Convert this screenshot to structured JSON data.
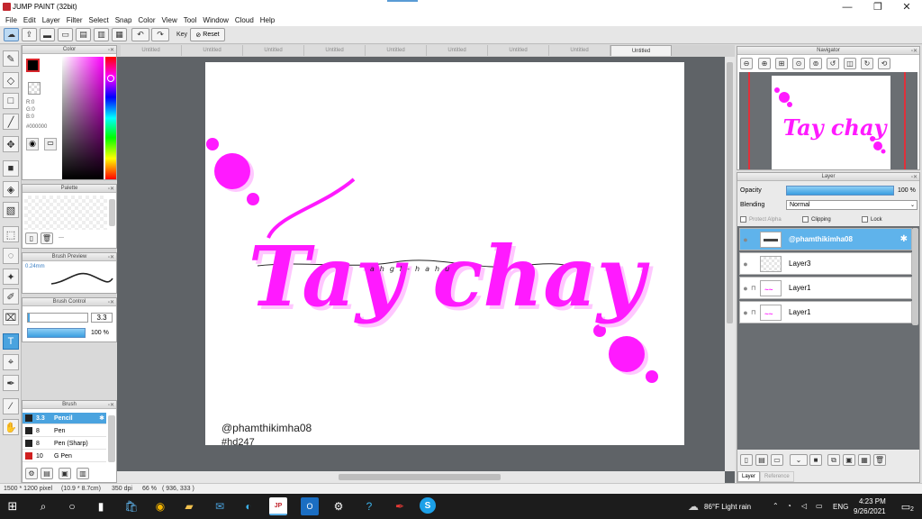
{
  "window": {
    "title": "JUMP PAINT (32bit)",
    "minimize": "—",
    "restore": "❐",
    "close": "✕"
  },
  "menu": [
    "File",
    "Edit",
    "Layer",
    "Filter",
    "Select",
    "Snap",
    "Color",
    "View",
    "Tool",
    "Window",
    "Cloud",
    "Help"
  ],
  "toolbar": {
    "key_label": "Key",
    "reset_label": "Reset"
  },
  "color_panel": {
    "title": "Color",
    "r": "R:0",
    "g": "G:0",
    "b": "B:0",
    "hex": "#000000",
    "current_color": "#000000"
  },
  "palette_panel": {
    "title": "Palette"
  },
  "brush_preview": {
    "title": "Brush Preview",
    "size": "0.24mm"
  },
  "brush_control": {
    "title": "Brush Control",
    "size_value": "3.3",
    "opacity_value": "100 %"
  },
  "brush_panel": {
    "title": "Brush",
    "items": [
      {
        "size": "3.3",
        "name": "Pencil",
        "color": "#222222"
      },
      {
        "size": "8",
        "name": "Pen",
        "color": "#222222"
      },
      {
        "size": "8",
        "name": "Pen (Sharp)",
        "color": "#222222"
      },
      {
        "size": "10",
        "name": "G Pen",
        "color": "#d02020"
      }
    ]
  },
  "tabs": [
    "Untitled",
    "Untitled",
    "Untitled",
    "Untitled",
    "Untitled",
    "Untitled",
    "Untitled",
    "Untitled",
    "Untitled"
  ],
  "artwork": {
    "title_text": "Tay chay",
    "handwriting": "ahgl-hahu",
    "credit": "@phamthikimha08",
    "hashtag": "#hd247",
    "accent": "#ff1aff"
  },
  "navigator": {
    "title": "Navigator"
  },
  "layer_panel": {
    "title": "Layer",
    "opacity_label": "Opacity",
    "opacity_value": "100 %",
    "opacity_fraction": 1.0,
    "blending_label": "Blending",
    "blending_value": "Normal",
    "protect_alpha": "Protect Alpha",
    "clipping": "Clipping",
    "lock": "Lock",
    "layers": [
      {
        "name": "@phamthikimha08"
      },
      {
        "name": "Layer3"
      },
      {
        "name": "Layer1"
      },
      {
        "name": "Layer1"
      }
    ],
    "tab_layer": "Layer",
    "tab_reference": "Reference"
  },
  "status": {
    "dimensions": "1500 * 1200 pixel",
    "physical": "(10.9 * 8.7cm)",
    "dpi": "350 dpi",
    "zoom": "66 %",
    "cursor": "( 936, 333 )"
  },
  "taskbar": {
    "weather": "86°F Light rain",
    "lang": "ENG",
    "time": "4:23 PM",
    "date": "9/26/2021",
    "notifications": "2"
  }
}
